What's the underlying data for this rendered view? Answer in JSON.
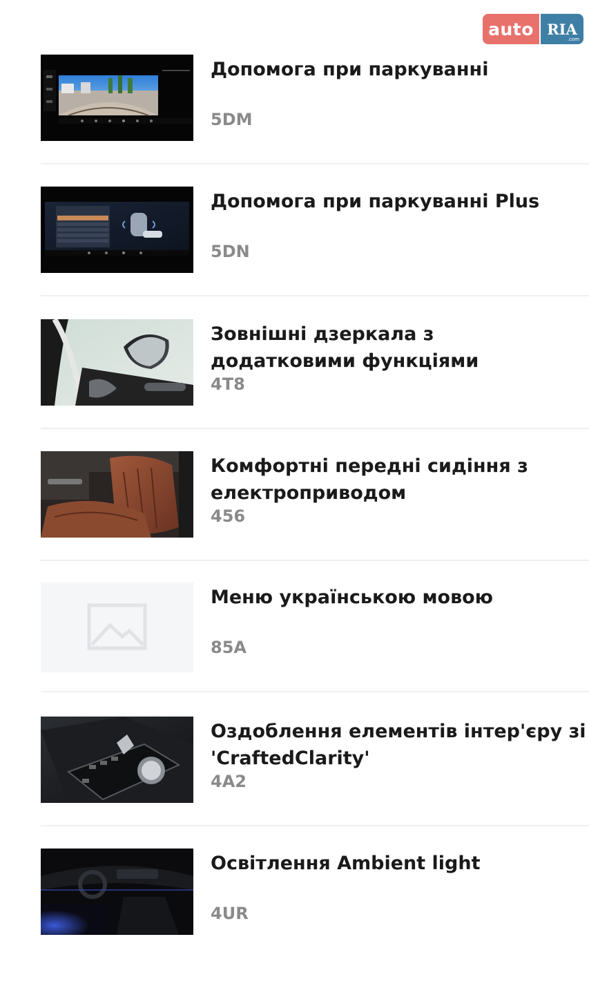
{
  "logo": {
    "left": "auto",
    "right": "RIA",
    "sub": ".com"
  },
  "items": [
    {
      "title_lines": [
        "Допомога при паркуванні"
      ],
      "code": "5DM",
      "thumb": "parking-camera-screen"
    },
    {
      "title_lines": [
        "Допомога при паркуванні Plus"
      ],
      "code": "5DN",
      "thumb": "parking-plus-screen"
    },
    {
      "title_lines": [
        "Зовнішні дзеркала з",
        "додатковими функціями"
      ],
      "code": "4T8",
      "thumb": "exterior-mirror-photo"
    },
    {
      "title_lines": [
        "Комфортні передні сидіння з",
        "електроприводом"
      ],
      "code": "456",
      "thumb": "comfort-seats-photo"
    },
    {
      "title_lines": [
        "Меню українською мовою"
      ],
      "code": "85A",
      "thumb": "image-placeholder-icon"
    },
    {
      "title_lines": [
        "Оздоблення елементів інтер'єру зі ск",
        "'CraftedClarity'"
      ],
      "code": "4A2",
      "thumb": "crafted-clarity-controls-photo"
    },
    {
      "title_lines": [
        "Освітлення Ambient light"
      ],
      "code": "4UR",
      "thumb": "ambient-light-interior-photo"
    }
  ]
}
